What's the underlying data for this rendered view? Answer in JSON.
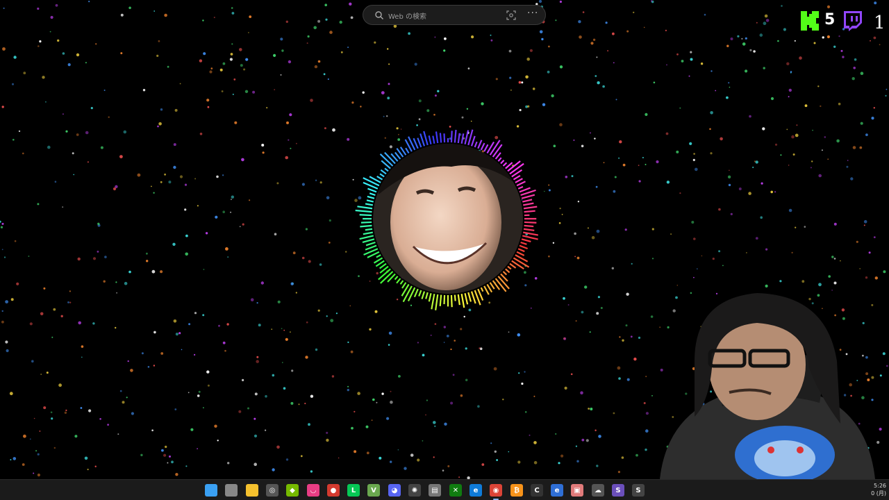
{
  "search": {
    "placeholder": "Web の検索",
    "more_label": "···"
  },
  "overlay": {
    "kick_count": "5",
    "twitch_count": "1"
  },
  "colors": {
    "kick_green": "#53fc18",
    "twitch_purple": "#9146ff",
    "background": "#000000"
  },
  "taskbar": {
    "icons": [
      {
        "name": "windows-start-icon",
        "color": "#3aa0f3",
        "glyph": ""
      },
      {
        "name": "task-view-icon",
        "color": "#888888",
        "glyph": ""
      },
      {
        "name": "file-explorer-icon",
        "color": "#f5c12e",
        "glyph": ""
      },
      {
        "name": "chrome-dev-icon",
        "color": "#555555",
        "glyph": "◎"
      },
      {
        "name": "nvidia-icon",
        "color": "#76b900",
        "glyph": "◆"
      },
      {
        "name": "lips-app-icon",
        "color": "#e83d84",
        "glyph": "◡"
      },
      {
        "name": "record-icon",
        "color": "#d33a2f",
        "glyph": "●"
      },
      {
        "name": "line-icon",
        "color": "#06c755",
        "glyph": "L"
      },
      {
        "name": "v-app-icon",
        "color": "#6aa84f",
        "glyph": "V"
      },
      {
        "name": "discord-icon",
        "color": "#5865f2",
        "glyph": "◕"
      },
      {
        "name": "chatgpt-icon",
        "color": "#444444",
        "glyph": "✺"
      },
      {
        "name": "notepad-icon",
        "color": "#777777",
        "glyph": "▤"
      },
      {
        "name": "xbox-icon",
        "color": "#107c10",
        "glyph": "✕"
      },
      {
        "name": "edge-icon",
        "color": "#0f7bd8",
        "glyph": "e"
      },
      {
        "name": "chrome-icon",
        "color": "#db4437",
        "glyph": "◉",
        "active": true
      },
      {
        "name": "bitcoin-icon",
        "color": "#f7931a",
        "glyph": "₿"
      },
      {
        "name": "app-c-icon",
        "color": "#333333",
        "glyph": "C"
      },
      {
        "name": "browser-icon",
        "color": "#2f6fd6",
        "glyph": "e"
      },
      {
        "name": "image-app-icon",
        "color": "#e07a7a",
        "glyph": "▣"
      },
      {
        "name": "cloud-app-icon",
        "color": "#555555",
        "glyph": "☁"
      },
      {
        "name": "obs-icon",
        "color": "#6b4fbb",
        "glyph": "S"
      },
      {
        "name": "overflow-app-icon",
        "color": "#444444",
        "glyph": "S"
      }
    ],
    "clock_time": "5:26",
    "clock_date": "0 (月)"
  }
}
